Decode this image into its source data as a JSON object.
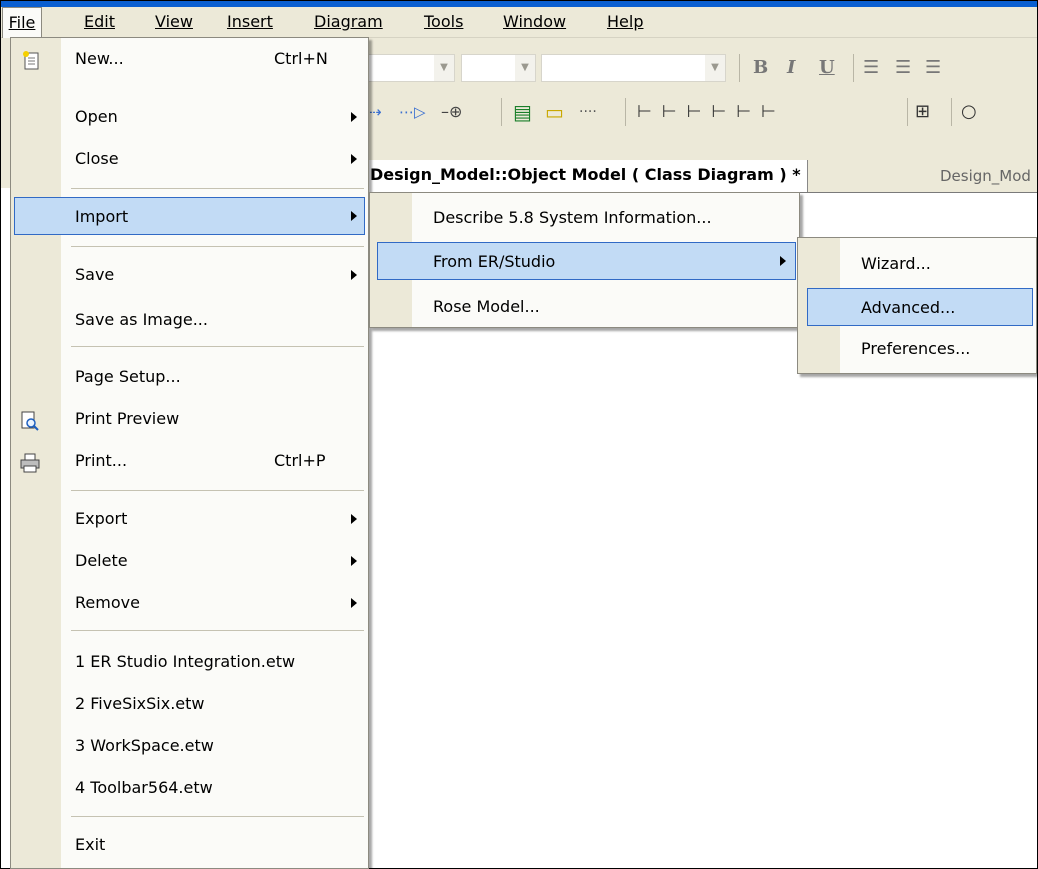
{
  "menubar": {
    "items": [
      {
        "label": "File",
        "mnemonic": "F"
      },
      {
        "label": "Edit",
        "mnemonic": "E"
      },
      {
        "label": "View",
        "mnemonic": "V"
      },
      {
        "label": "Insert",
        "mnemonic": "I"
      },
      {
        "label": "Diagram",
        "mnemonic": "D"
      },
      {
        "label": "Tools",
        "mnemonic": "T"
      },
      {
        "label": "Window",
        "mnemonic": "W"
      },
      {
        "label": "Help",
        "mnemonic": "H"
      }
    ]
  },
  "tabs": {
    "active": "Design_Model::Object Model ( Class Diagram ) *",
    "next": "Design_Mod"
  },
  "file_menu": {
    "items": [
      {
        "label": "New...",
        "mnemonic": "N",
        "shortcut": "Ctrl+N",
        "icon": "new-document-icon"
      },
      {
        "label": "Open",
        "mnemonic": "O",
        "submenu": true
      },
      {
        "label": "Close",
        "mnemonic": "C",
        "submenu": true
      },
      {
        "label": "Import",
        "mnemonic": "I",
        "submenu": true,
        "highlighted": true
      },
      {
        "label": "Save",
        "mnemonic": "S",
        "submenu": true
      },
      {
        "label": "Save as Image...",
        "mnemonic": "a"
      },
      {
        "label": "Page Setup...",
        "mnemonic": "u"
      },
      {
        "label": "Print Preview",
        "mnemonic": "v",
        "icon": "print-preview-icon"
      },
      {
        "label": "Print...",
        "mnemonic": "P",
        "shortcut": "Ctrl+P",
        "icon": "printer-icon"
      },
      {
        "label": "Export",
        "mnemonic": "E",
        "submenu": true
      },
      {
        "label": "Delete",
        "mnemonic": "D",
        "submenu": true
      },
      {
        "label": "Remove",
        "mnemonic": "R",
        "submenu": true
      },
      {
        "label": "1 ER Studio Integration.etw",
        "mnemonic": "1"
      },
      {
        "label": "2 FiveSixSix.etw",
        "mnemonic": "2"
      },
      {
        "label": "3 WorkSpace.etw",
        "mnemonic": "3"
      },
      {
        "label": "4 Toolbar564.etw",
        "mnemonic": "4"
      },
      {
        "label": "Exit",
        "mnemonic": "x"
      }
    ]
  },
  "import_menu": {
    "items": [
      {
        "label": "Describe 5.8 System Information...",
        "mnemonic": "D"
      },
      {
        "label": "From ER/Studio",
        "mnemonic": "E",
        "submenu": true,
        "highlighted": true
      },
      {
        "label": "Rose Model...",
        "mnemonic": "R"
      }
    ]
  },
  "erstudio_menu": {
    "items": [
      {
        "label": "Wizard...",
        "mnemonic": "W"
      },
      {
        "label": "Advanced...",
        "mnemonic": "A",
        "highlighted": true
      },
      {
        "label": "Preferences...",
        "mnemonic": "P"
      }
    ]
  },
  "colors": {
    "menu_bg": "#fbfbf8",
    "gutter": "#ece9d8",
    "highlight": "#c2dbf5",
    "highlight_border": "#316ac5",
    "title_blue": "#0a5fd1"
  }
}
